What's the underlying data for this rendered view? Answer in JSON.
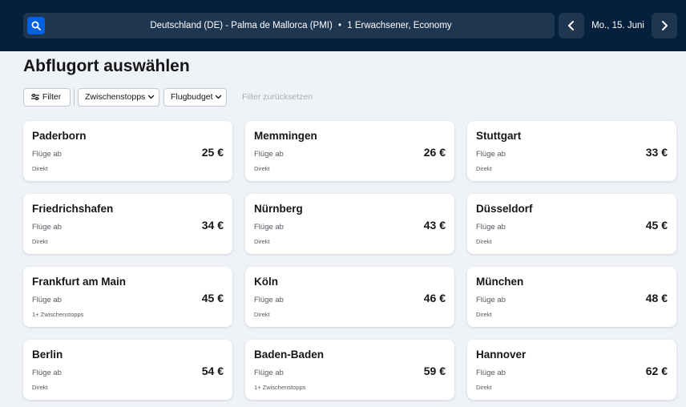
{
  "header": {
    "search_summary_route": "Deutschland (DE) - Palma de Mallorca (PMI)",
    "search_summary_separator": "•",
    "search_summary_passengers": "1 Erwachsener, Economy",
    "date": "Mo., 15. Juni",
    "icons": {
      "search": "search-icon",
      "prev": "chevron-left-icon",
      "next": "chevron-right-icon"
    }
  },
  "page": {
    "title": "Abflugort auswählen"
  },
  "filters": {
    "filter_label": "Filter",
    "stops_label": "Zwischenstopps",
    "budget_label": "Flugbudget",
    "reset_label": "Filter zurücksetzen"
  },
  "colors": {
    "header_bg": "#05203c",
    "accent": "#0062e3",
    "page_bg": "#eff3f8"
  },
  "results": [
    {
      "city": "Paderborn",
      "sub": "Flüge ab",
      "stops": "Direkt",
      "price": "25 €"
    },
    {
      "city": "Memmingen",
      "sub": "Flüge ab",
      "stops": "Direkt",
      "price": "26 €"
    },
    {
      "city": "Stuttgart",
      "sub": "Flüge ab",
      "stops": "Direkt",
      "price": "33 €"
    },
    {
      "city": "Friedrichshafen",
      "sub": "Flüge ab",
      "stops": "Direkt",
      "price": "34 €"
    },
    {
      "city": "Nürnberg",
      "sub": "Flüge ab",
      "stops": "Direkt",
      "price": "43 €"
    },
    {
      "city": "Düsseldorf",
      "sub": "Flüge ab",
      "stops": "Direkt",
      "price": "45 €"
    },
    {
      "city": "Frankfurt am Main",
      "sub": "Flüge ab",
      "stops": "1+ Zwischenstopps",
      "price": "45 €"
    },
    {
      "city": "Köln",
      "sub": "Flüge ab",
      "stops": "Direkt",
      "price": "46 €"
    },
    {
      "city": "München",
      "sub": "Flüge ab",
      "stops": "Direkt",
      "price": "48 €"
    },
    {
      "city": "Berlin",
      "sub": "Flüge ab",
      "stops": "Direkt",
      "price": "54 €"
    },
    {
      "city": "Baden-Baden",
      "sub": "Flüge ab",
      "stops": "1+ Zwischenstopps",
      "price": "59 €"
    },
    {
      "city": "Hannover",
      "sub": "Flüge ab",
      "stops": "Direkt",
      "price": "62 €"
    }
  ]
}
